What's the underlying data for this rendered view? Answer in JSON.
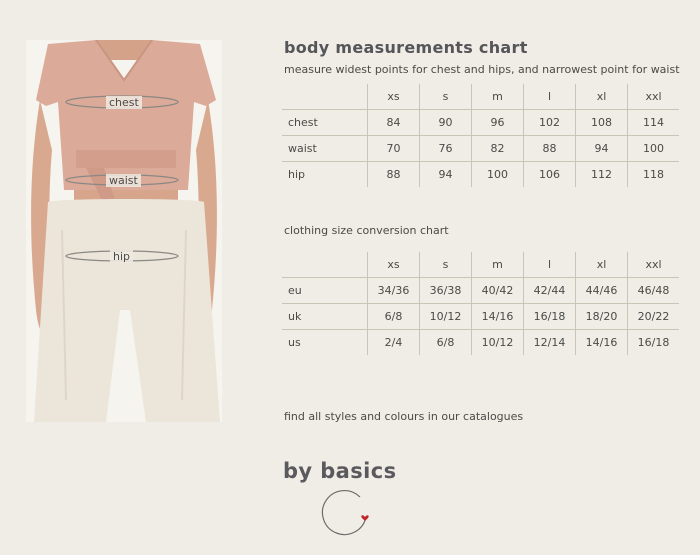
{
  "photo": {
    "labels": {
      "chest": "chest",
      "waist": "waist",
      "hip": "hip"
    }
  },
  "body_chart": {
    "title": "body measurements chart",
    "subtitle": "measure widest points for chest and hips, and narrowest point for waist",
    "sizes": [
      "xs",
      "s",
      "m",
      "l",
      "xl",
      "xxl"
    ],
    "rows": [
      {
        "label": "chest",
        "values": [
          "84",
          "90",
          "96",
          "102",
          "108",
          "114"
        ]
      },
      {
        "label": "waist",
        "values": [
          "70",
          "76",
          "82",
          "88",
          "94",
          "100"
        ]
      },
      {
        "label": "hip",
        "values": [
          "88",
          "94",
          "100",
          "106",
          "112",
          "118"
        ]
      }
    ]
  },
  "conversion_chart": {
    "title": "clothing size conversion chart",
    "sizes": [
      "xs",
      "s",
      "m",
      "l",
      "xl",
      "xxl"
    ],
    "rows": [
      {
        "label": "eu",
        "values": [
          "34/36",
          "36/38",
          "40/42",
          "42/44",
          "44/46",
          "46/48"
        ]
      },
      {
        "label": "uk",
        "values": [
          "6/8",
          "10/12",
          "14/16",
          "16/18",
          "18/20",
          "20/22"
        ]
      },
      {
        "label": "us",
        "values": [
          "2/4",
          "6/8",
          "10/12",
          "12/14",
          "14/16",
          "16/18"
        ]
      }
    ]
  },
  "footer": {
    "text": "find all styles and colours in our catalogues"
  },
  "brand": {
    "name": "by basics"
  },
  "colors": {
    "accent_heart": "#c0262d",
    "top": "#dcaa98",
    "pants": "#ece6da",
    "skin": "#d9a98f"
  }
}
